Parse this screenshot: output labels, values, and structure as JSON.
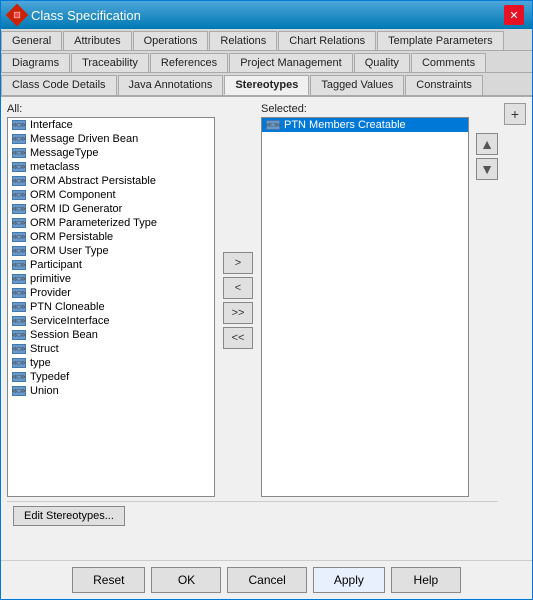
{
  "window": {
    "title": "Class Specification"
  },
  "tabs_row1": [
    {
      "label": "General",
      "active": false
    },
    {
      "label": "Attributes",
      "active": false
    },
    {
      "label": "Operations",
      "active": false
    },
    {
      "label": "Relations",
      "active": false
    },
    {
      "label": "Chart Relations",
      "active": false
    },
    {
      "label": "Template Parameters",
      "active": false
    }
  ],
  "tabs_row2": [
    {
      "label": "Diagrams",
      "active": false
    },
    {
      "label": "Traceability",
      "active": false
    },
    {
      "label": "References",
      "active": false
    },
    {
      "label": "Project Management",
      "active": false
    },
    {
      "label": "Quality",
      "active": false
    },
    {
      "label": "Comments",
      "active": false
    }
  ],
  "tabs_row3": [
    {
      "label": "Class Code Details",
      "active": false
    },
    {
      "label": "Java Annotations",
      "active": false
    },
    {
      "label": "Stereotypes",
      "active": true
    },
    {
      "label": "Tagged Values",
      "active": false
    },
    {
      "label": "Constraints",
      "active": false
    }
  ],
  "all_label": "All:",
  "selected_label": "Selected:",
  "all_items": [
    "Interface",
    "Message Driven Bean",
    "MessageType",
    "metaclass",
    "ORM Abstract Persistable",
    "ORM Component",
    "ORM ID Generator",
    "ORM Parameterized Type",
    "ORM Persistable",
    "ORM User Type",
    "Participant",
    "primitive",
    "Provider",
    "PTN Cloneable",
    "ServiceInterface",
    "Session Bean",
    "Struct",
    "type",
    "Typedef",
    "Union"
  ],
  "selected_items": [
    {
      "label": "PTN Members Creatable",
      "active": true
    }
  ],
  "move_buttons": {
    "right": ">",
    "left": "<",
    "all_right": ">>",
    "all_left": "<<"
  },
  "edit_stereotypes_label": "Edit Stereotypes...",
  "footer_buttons": {
    "reset": "Reset",
    "ok": "OK",
    "cancel": "Cancel",
    "apply": "Apply",
    "help": "Help"
  }
}
